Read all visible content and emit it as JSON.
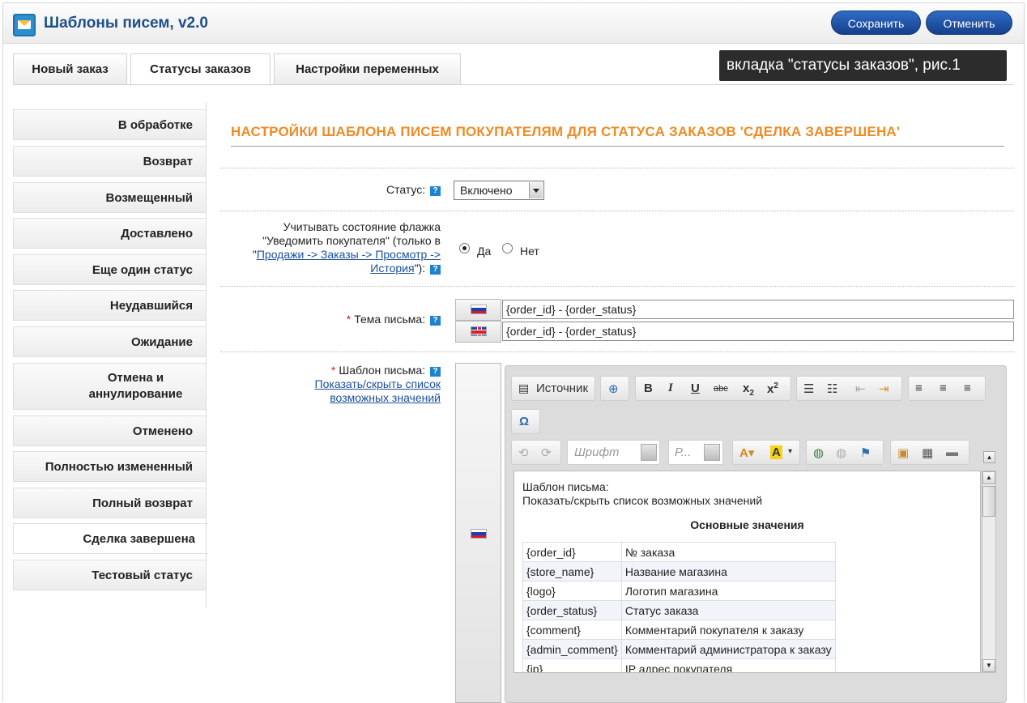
{
  "header": {
    "title": "Шаблоны писем, v2.0",
    "save_label": "Сохранить",
    "cancel_label": "Отменить"
  },
  "tabs": [
    {
      "label": "Новый заказ",
      "active": false
    },
    {
      "label": "Статусы заказов",
      "active": true
    },
    {
      "label": "Настройки переменных",
      "active": false
    }
  ],
  "note": "вкладка \"статусы заказов\", рис.1",
  "sidebar": {
    "items": [
      {
        "label": "В обработке"
      },
      {
        "label": "Возврат"
      },
      {
        "label": "Возмещенный"
      },
      {
        "label": "Доставлено"
      },
      {
        "label": "Еще один статус"
      },
      {
        "label": "Неудавшийся"
      },
      {
        "label": "Ожидание"
      },
      {
        "label": "Отмена и аннулирование"
      },
      {
        "label": "Отменено"
      },
      {
        "label": "Полностью измененный"
      },
      {
        "label": "Полный возврат"
      },
      {
        "label": "Сделка завершена",
        "active": true
      },
      {
        "label": "Тестовый статус"
      }
    ]
  },
  "main": {
    "title": "НАСТРОЙКИ ШАБЛОНА ПИСЕМ ПОКУПАТЕЛЯМ ДЛЯ СТАТУСА ЗАКАЗОВ 'СДЕЛКА ЗАВЕРШЕНА'",
    "status": {
      "label": "Статус:",
      "value": "Включено"
    },
    "notify": {
      "line1": "Учитывать состояние флажка",
      "line2": "\"Уведомить покупателя\" (только в",
      "quote_open": "\"",
      "link1": "Продажи -> Заказы -> Просмотр ->",
      "link2": "История",
      "suffix": "\"):",
      "yes_label": "Да",
      "no_label": "Нет",
      "selected": "Да"
    },
    "subject": {
      "required_mark": "*",
      "label": "Тема письма:",
      "values": [
        "{order_id} - {order_status}",
        "{order_id} - {order_status}"
      ]
    },
    "template": {
      "required_mark": "*",
      "label": "Шаблон письма:",
      "toggle_link_line1": "Показать/скрыть список",
      "toggle_link_line2": "возможных значений"
    }
  },
  "editor": {
    "source_label": "Источник",
    "font_placeholder": "Шрифт",
    "size_placeholder": "Р...",
    "content": {
      "line1": "Шаблон письма:",
      "line2": "Показать/скрыть список возможных значений",
      "heading": "Основные значения",
      "rows": [
        {
          "key": "{order_id}",
          "desc": "№ заказа"
        },
        {
          "key": "{store_name}",
          "desc": "Название магазина"
        },
        {
          "key": "{logo}",
          "desc": "Логотип магазина"
        },
        {
          "key": "{order_status}",
          "desc": "Статус заказа"
        },
        {
          "key": "{comment}",
          "desc": "Комментарий покупателя к заказу"
        },
        {
          "key": "{admin_comment}",
          "desc": "Комментарий администратора к заказу"
        },
        {
          "key": "{ip}",
          "desc": "IP адрес покупателя"
        }
      ]
    }
  },
  "colors": {
    "accent_title": "#f08a24",
    "header_title": "#1d4f8a",
    "button": "#1f4fa6"
  }
}
